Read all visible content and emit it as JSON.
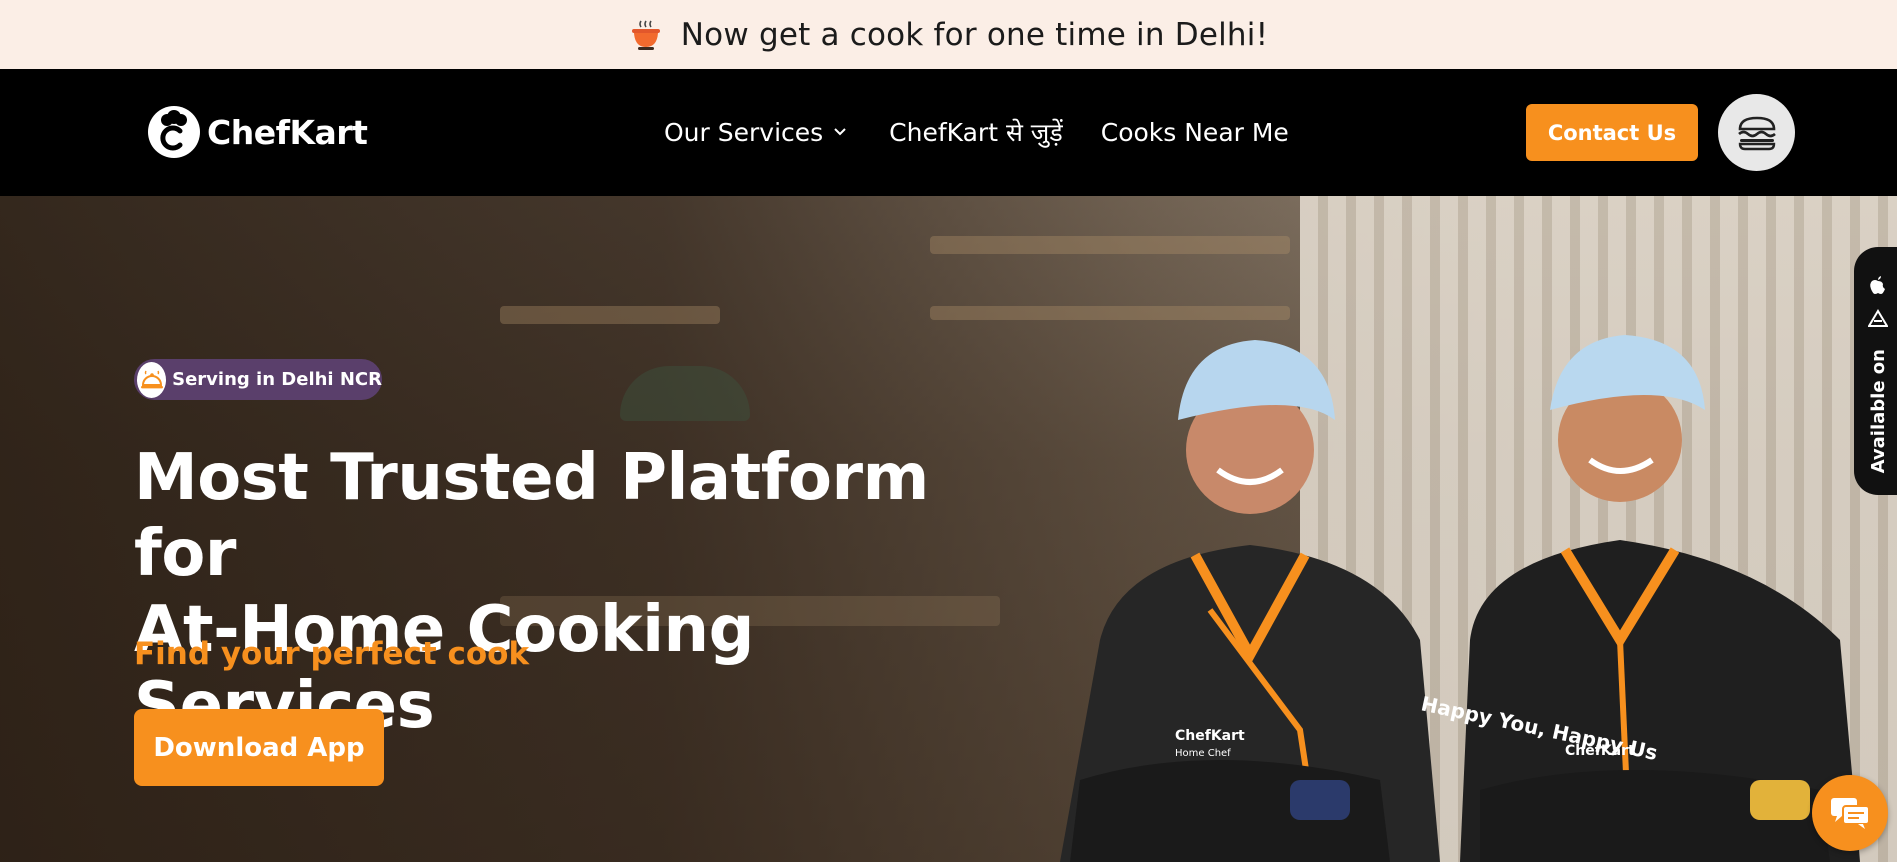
{
  "announcement": {
    "text": "Now get a cook for one time in Delhi!",
    "icon": "bowl-icon"
  },
  "nav": {
    "brand": "ChefKart",
    "links": [
      {
        "label": "Our Services",
        "has_dropdown": true
      },
      {
        "label": "ChefKart से जुड़ें"
      },
      {
        "label": "Cooks Near Me"
      }
    ],
    "contact_label": "Contact Us",
    "menu_icon": "burger-icon"
  },
  "hero": {
    "badge": "Serving in Delhi NCR",
    "title_line1": "Most Trusted Platform for",
    "title_line2": "At-Home Cooking Services",
    "subtitle": "Find your perfect cook",
    "cta": "Download App"
  },
  "side_tab": {
    "label": "Available on",
    "icons": [
      "apple-icon",
      "play-store-icon"
    ]
  },
  "chefs": {
    "shirt_text": "Happy You, Happy Us",
    "shirt_brand": "ChefKart",
    "shirt_caption": "Home Chef"
  },
  "colors": {
    "accent": "#f7901e",
    "announce_bg": "#fbeee6",
    "nav_bg": "#000000",
    "badge_bg": "#5a3f6b"
  }
}
